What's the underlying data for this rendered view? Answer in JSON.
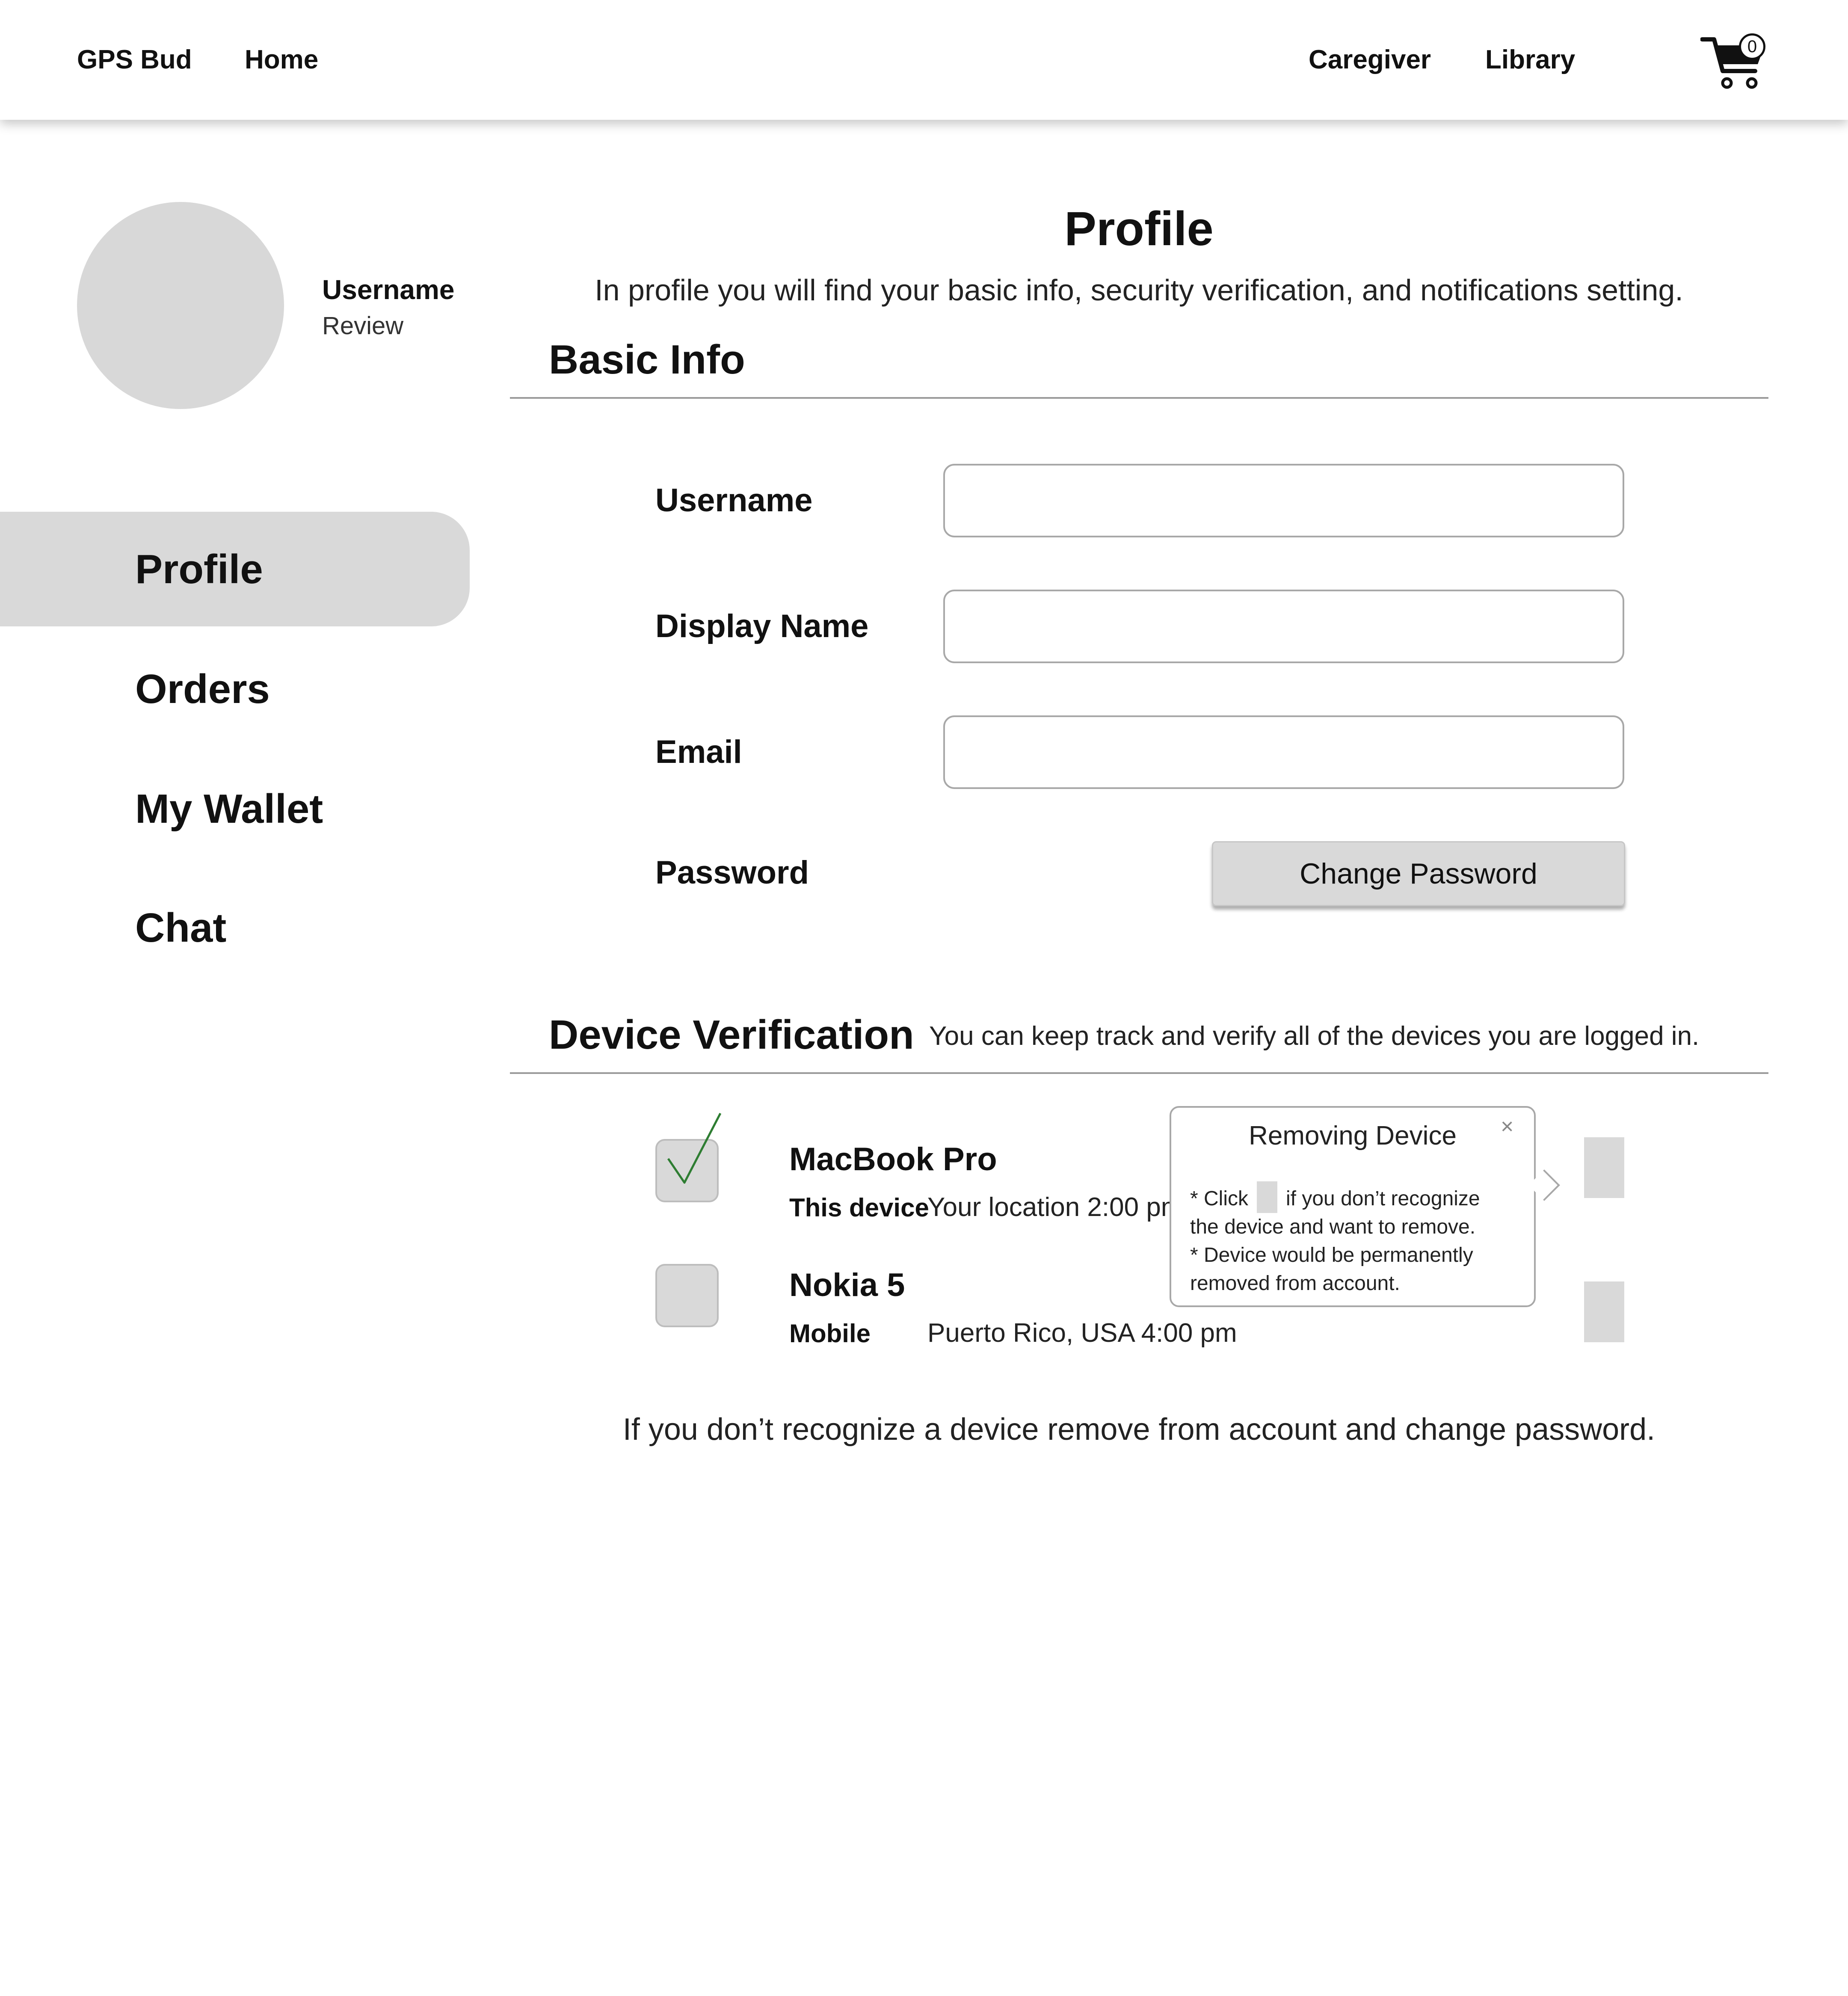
{
  "nav": {
    "brand": "GPS Bud",
    "home": "Home",
    "caregiver": "Caregiver",
    "library": "Library",
    "cart_icon": "shopping-cart-icon",
    "cart_count": "0"
  },
  "sidebar": {
    "username": "Username",
    "subtitle": "Review",
    "items": [
      {
        "label": "Profile",
        "active": true
      },
      {
        "label": "Orders",
        "active": false
      },
      {
        "label": "My Wallet",
        "active": false
      },
      {
        "label": "Chat",
        "active": false
      }
    ]
  },
  "profile": {
    "title": "Profile",
    "subtitle": "In profile you will find your basic info, security verification, and notifications setting."
  },
  "basic_info": {
    "title": "Basic Info",
    "fields": [
      {
        "label": "Username",
        "value": ""
      },
      {
        "label": "Display Name",
        "value": ""
      },
      {
        "label": "Email",
        "value": ""
      }
    ],
    "password_label": "Password",
    "change_password_button": "Change Password"
  },
  "device_verification": {
    "title": "Device Verification",
    "description": "You can keep track and verify all of the devices you are logged in.",
    "devices": [
      {
        "name": "MacBook Pro",
        "type": "This device",
        "details": "Your location 2:00 pm",
        "verified": true
      },
      {
        "name": "Nokia 5",
        "type": "Mobile",
        "details": "Puerto Rico, USA 4:00 pm",
        "verified": false
      }
    ],
    "popover": {
      "title": "Removing Device",
      "close_icon": "close-icon",
      "line1_before": "* Click",
      "line1_after": "if you don’t recognize",
      "line2": "the device and want to remove.",
      "line3": "* Device would be permanently",
      "line4": "removed from account."
    },
    "footer_note": "If you don’t recognize a device remove from account and change password."
  },
  "colors": {
    "placeholder_gray": "#d9d9d9",
    "check_green": "#2e7d32",
    "divider": "#9a9a9a",
    "input_border": "#a8a8a8"
  }
}
